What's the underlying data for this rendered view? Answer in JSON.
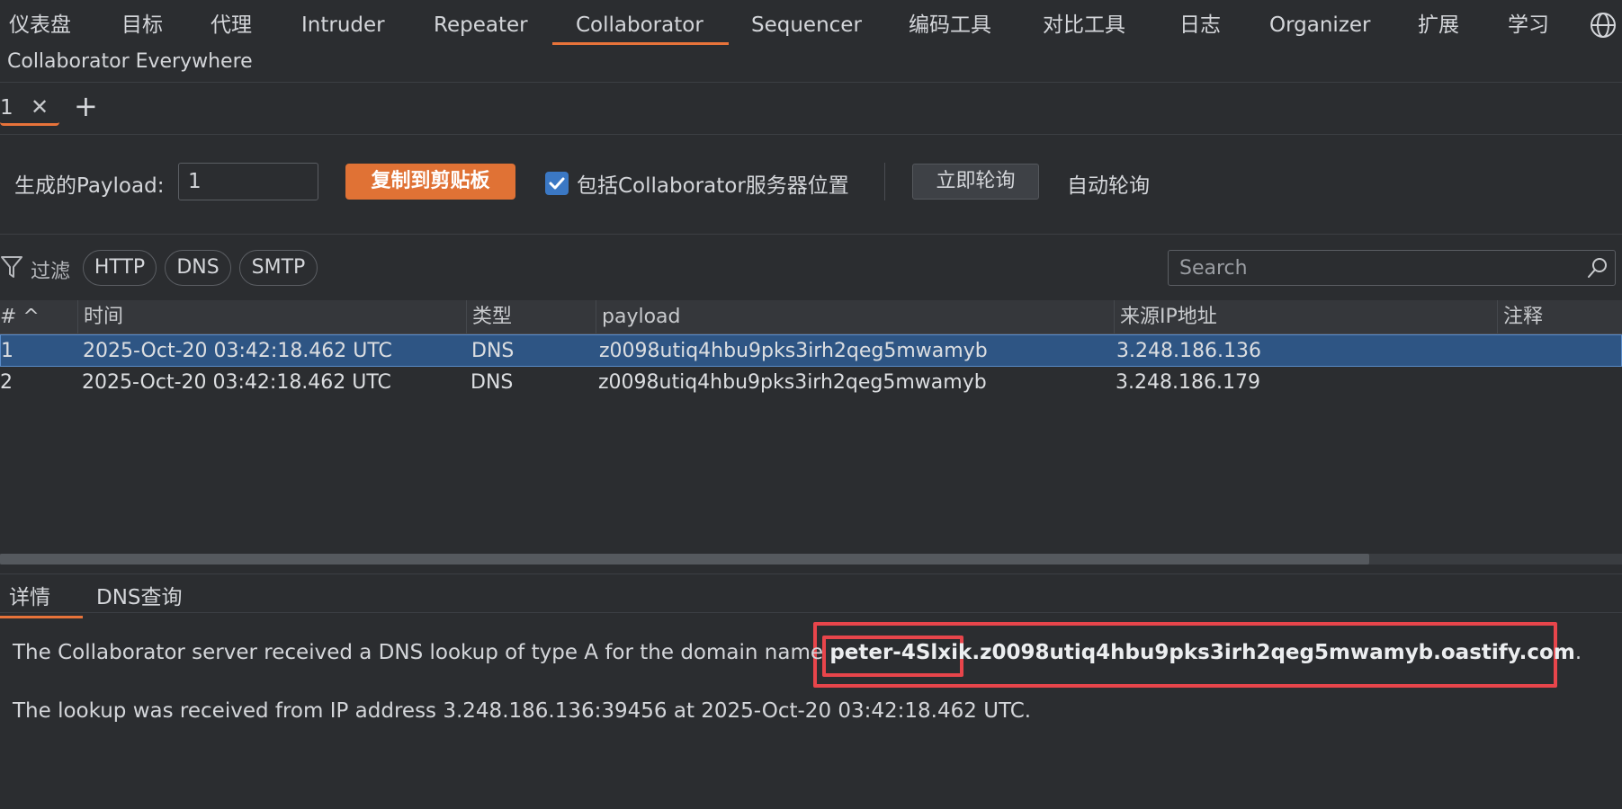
{
  "nav": {
    "tabs": [
      "仪表盘",
      "目标",
      "代理",
      "Intruder",
      "Repeater",
      "Collaborator",
      "Sequencer",
      "编码工具",
      "对比工具",
      "日志",
      "Organizer",
      "扩展",
      "学习"
    ],
    "active_tab": "Collaborator",
    "second_row": "Collaborator Everywhere",
    "globe_icon": "globe-icon"
  },
  "session": {
    "tab_number": "1",
    "close_symbol": "✕",
    "add_symbol": "+"
  },
  "controls": {
    "payload_label": "生成的Payload:",
    "payload_value": "1",
    "copy_button": "复制到剪贴板",
    "include_location_label": "包括Collaborator服务器位置",
    "include_location_checked": true,
    "poll_now_button": "立即轮询",
    "auto_poll_label": "自动轮询",
    "accent_color": "#e07235"
  },
  "filter": {
    "label": "过滤",
    "chips": [
      "HTTP",
      "DNS",
      "SMTP"
    ],
    "search_placeholder": "Search"
  },
  "table": {
    "columns": [
      "# ^",
      "时间",
      "类型",
      "payload",
      "来源IP地址",
      "注释"
    ],
    "rows": [
      {
        "num": "1",
        "time": "2025-Oct-20 03:42:18.462 UTC",
        "type": "DNS",
        "payload": "z0098utiq4hbu9pks3irh2qeg5mwamyb",
        "ip": "3.248.186.136",
        "comment": ""
      },
      {
        "num": "2",
        "time": "2025-Oct-20 03:42:18.462 UTC",
        "type": "DNS",
        "payload": "z0098utiq4hbu9pks3irh2qeg5mwamyb",
        "ip": "3.248.186.179",
        "comment": ""
      }
    ],
    "selected_row": 1
  },
  "details": {
    "tabs": [
      "详情",
      "DNS查询"
    ],
    "active_tab": "详情",
    "line1_prefix": "The Collaborator server received a DNS lookup of type A for the domain name ",
    "line1_domain_part1": "peter-4Slxik",
    "line1_domain_part2": ".z0098utiq4hbu9pks3irh2qeg5mwamyb.oastify.com",
    "line1_suffix": ".",
    "line2": "The lookup was received from IP address 3.248.186.136:39456 at 2025-Oct-20 03:42:18.462 UTC.",
    "highlight_color": "#e8454b"
  }
}
